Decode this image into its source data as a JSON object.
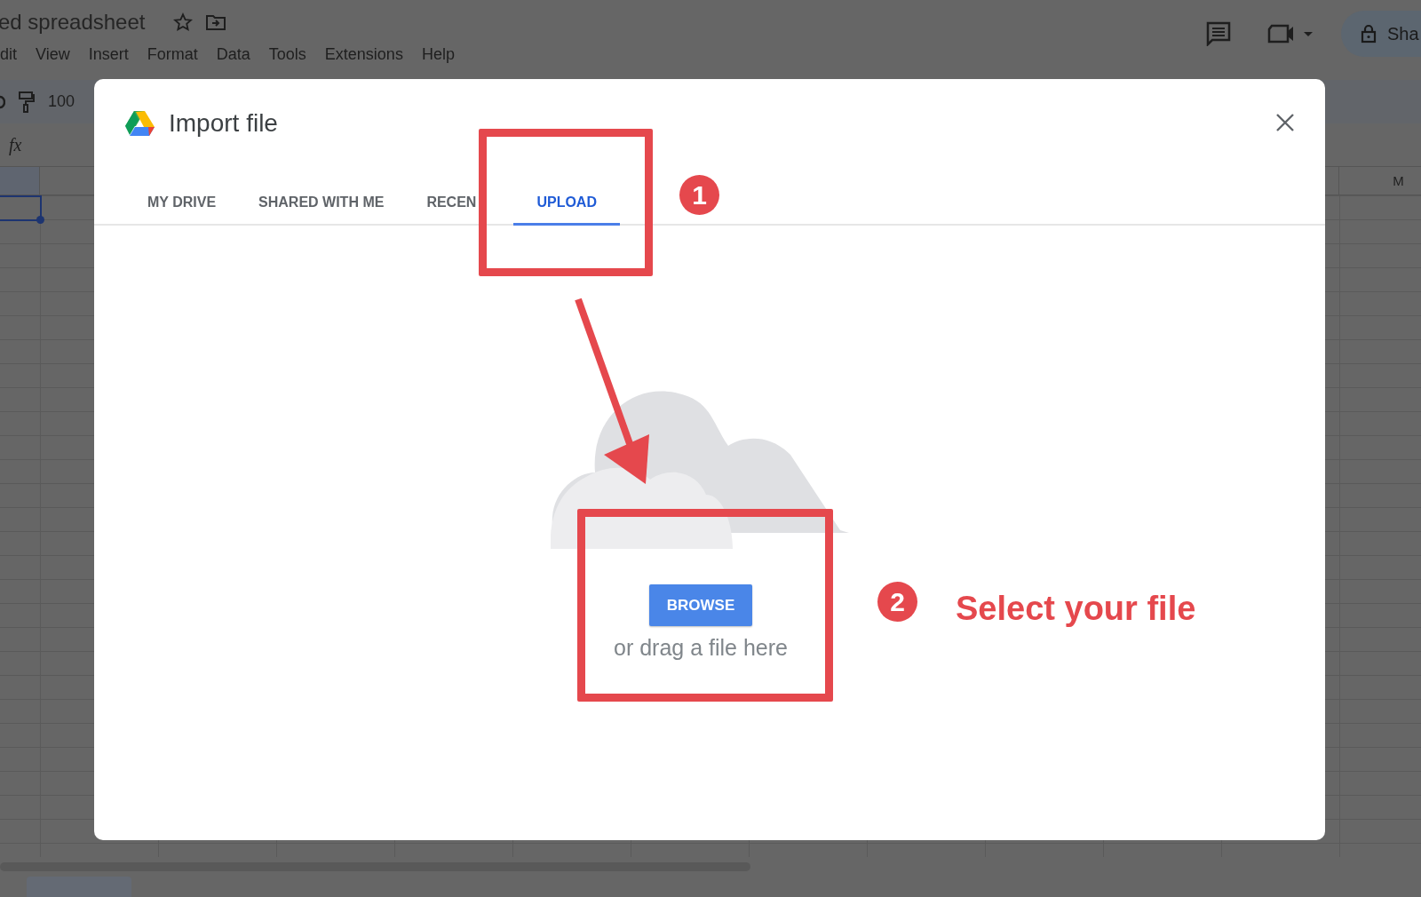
{
  "sheet": {
    "document_title": "ed spreadsheet",
    "menu": [
      "dit",
      "View",
      "Insert",
      "Format",
      "Data",
      "Tools",
      "Extensions",
      "Help"
    ],
    "share_button": "Sha",
    "zoom": "100",
    "formula_label": "fx",
    "column_header": "M"
  },
  "dialog": {
    "title": "Import file",
    "tabs": [
      {
        "label": "MY DRIVE",
        "selected": false
      },
      {
        "label": "SHARED WITH ME",
        "selected": false
      },
      {
        "label": "RECEN",
        "selected": false
      },
      {
        "label": "UPLOAD",
        "selected": true
      }
    ],
    "browse_button": "BROWSE",
    "drop_hint": "or drag a file here"
  },
  "annotations": {
    "step_1": "1",
    "step_2": "2",
    "caption": "Select your file"
  }
}
